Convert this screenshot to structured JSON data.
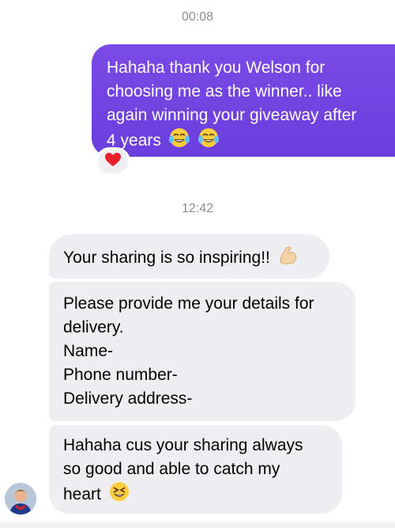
{
  "timestamps": [
    "00:08",
    "12:42"
  ],
  "outgoing_message": {
    "lines": [
      "Hahaha thank you Welson for",
      "choosing me as the winner.. like",
      "again winning your giveaway after",
      "4 years"
    ],
    "emoji_icons": [
      "tears-of-joy-emoji",
      "tears-of-joy-emoji"
    ],
    "reaction_icon": "red-heart-icon",
    "gradient_colors": [
      "#7b49e6",
      "#6a3fdc"
    ]
  },
  "incoming_messages": [
    {
      "lines": [
        "Your sharing is so inspiring!!"
      ],
      "emoji_icon": "flexed-biceps-emoji"
    },
    {
      "lines": [
        "Please provide me your details for",
        "delivery.",
        "Name-",
        "Phone number-",
        "Delivery address-"
      ]
    },
    {
      "lines": [
        "Hahaha cus your sharing always",
        "so good and able to catch my",
        "heart"
      ],
      "emoji_icon": "grinning-squinting-face-emoji"
    }
  ],
  "avatar_icon": "contact-avatar",
  "colors": {
    "incoming_bubble": "#eeeef0",
    "timestamp_text": "#8e8e93"
  }
}
